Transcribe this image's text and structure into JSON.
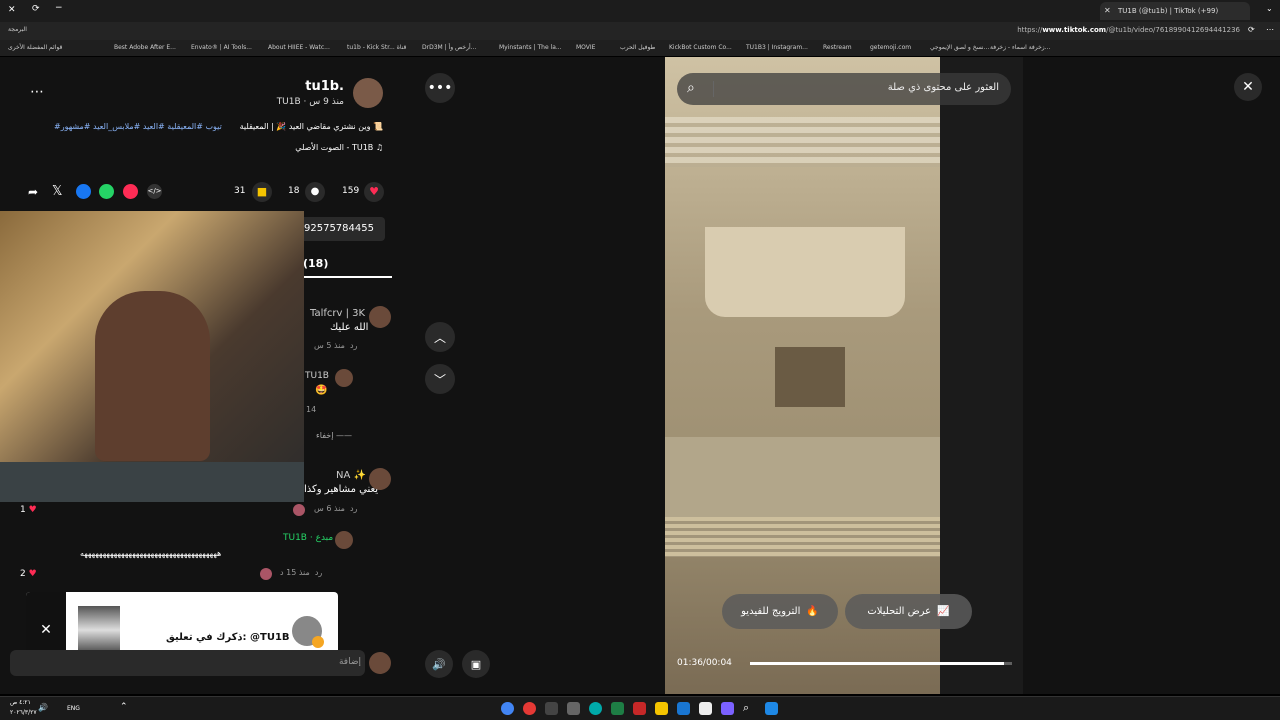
{
  "browser": {
    "tab_title": "TU1B (@tu1b) | TikTok (+99)",
    "url_prefix": "https://",
    "url_host": "www.tiktok.com",
    "url_path": "/@tu1b/video/7618990412694441236",
    "bookmark_label_folder": "البرمجة",
    "bookmarks": [
      "Best Adobe After E...",
      "Envato® | AI Tools...",
      "About HIIEE - Watc...",
      "tu1b - Kick Str... قناة",
      "DrD3M | أرخص وأ...",
      "Myinstants | The la...",
      "MOVIE",
      "طوفيل الحرب",
      "KickBot Custom Co...",
      "TU1B3 | Instagram...",
      "Restream",
      "getemoji.com",
      "نسخ و لصق الإيموجي...",
      "زخرفة اسماء - زخرفة..."
    ],
    "favorites_label": "قوائم المفضلة الأخرى"
  },
  "post": {
    "username": "tu1b.",
    "display_name": "TU1B",
    "time_ago": "منذ 9 س",
    "caption": "وين نشتري مقاضي العيد 🎉 | المعيقلية 📜",
    "hashtags": "#تيوب #المعيقلية #العيد #ملابس_العيد #مشهور",
    "sound": "الصوت الأصلي - TU1B",
    "likes": "159",
    "comments": "18",
    "saves": "31",
    "link_partial": "92575784455",
    "comments_tab": "(18)"
  },
  "comments": [
    {
      "name": "Talfcrv | 3K",
      "text": "الله عليك",
      "meta": "منذ 5 س",
      "reply": "رد"
    },
    {
      "name": "TU1B",
      "text": "🤩",
      "meta": "14",
      "reply": ""
    },
    {
      "name": "إخفاء",
      "text": "",
      "meta": "",
      "reply": ""
    },
    {
      "name": "NA ✨",
      "text": "يعني مشاهير وكذا",
      "meta": "منذ 6 س",
      "reply": "رد"
    },
    {
      "name": "TU1B · مبدع",
      "text": "هههههههههههههههههههههههههههههههههههههه",
      "meta": "منذ 15 د",
      "reply": "رد"
    }
  ],
  "like_counts": [
    "1",
    "2"
  ],
  "notification": {
    "text": "ذكرك في تعليق: @TU1B",
    "icon": "close-icon"
  },
  "comment_input_placeholder": "إضافة",
  "search": {
    "placeholder": "العثور على محتوى ذي صلة"
  },
  "video": {
    "time": "01:36/00:04",
    "promote_label": "الترويج للفيديو",
    "analytics_label": "عرض التحليلات",
    "progress": 0.97
  },
  "taskbar": {
    "time": "٤:٢١ ص",
    "date": "٢٠٢٦/٣/٢٧",
    "lang": "ENG"
  },
  "colors": {
    "accent": "#fe2c55",
    "hashtag": "#8ab4f8"
  }
}
